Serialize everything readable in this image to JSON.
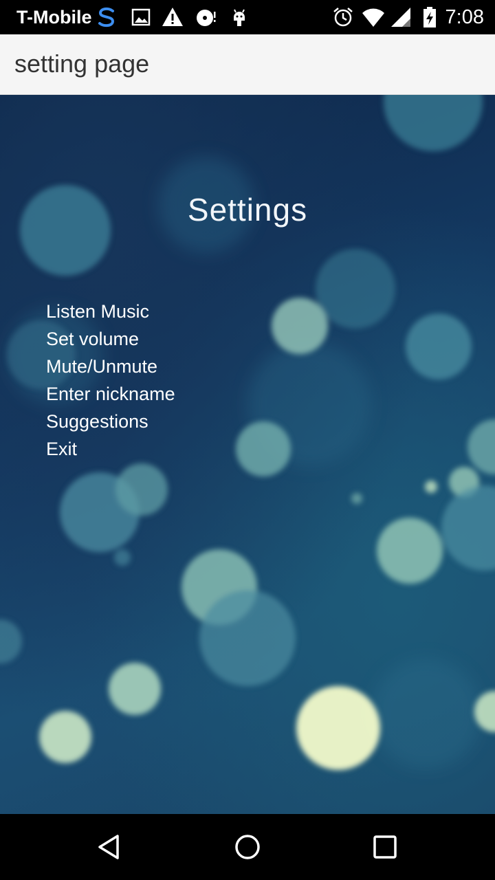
{
  "status_bar": {
    "carrier": "T-Mobile",
    "time": "7:08",
    "icons": [
      "sprint-s-icon",
      "image-icon",
      "warning-icon",
      "disc-icon",
      "android-icon",
      "alarm-icon",
      "wifi-icon",
      "signal-icon",
      "battery-icon"
    ]
  },
  "app_bar": {
    "title": "setting page"
  },
  "screen": {
    "heading": "Settings",
    "menu": [
      "Listen Music",
      "Set volume",
      "Mute/Unmute",
      "Enter nickname",
      "Suggestions",
      "Exit"
    ]
  },
  "nav_bar": {
    "buttons": [
      "back-icon",
      "home-icon",
      "recents-icon"
    ]
  },
  "colors": {
    "status_bar_bg": "#000000",
    "app_bar_bg": "#f5f5f5",
    "background_dark": "#0d2547",
    "background_light": "#1b4e73",
    "bokeh_light": "#eef7c8",
    "text": "#ffffff"
  }
}
